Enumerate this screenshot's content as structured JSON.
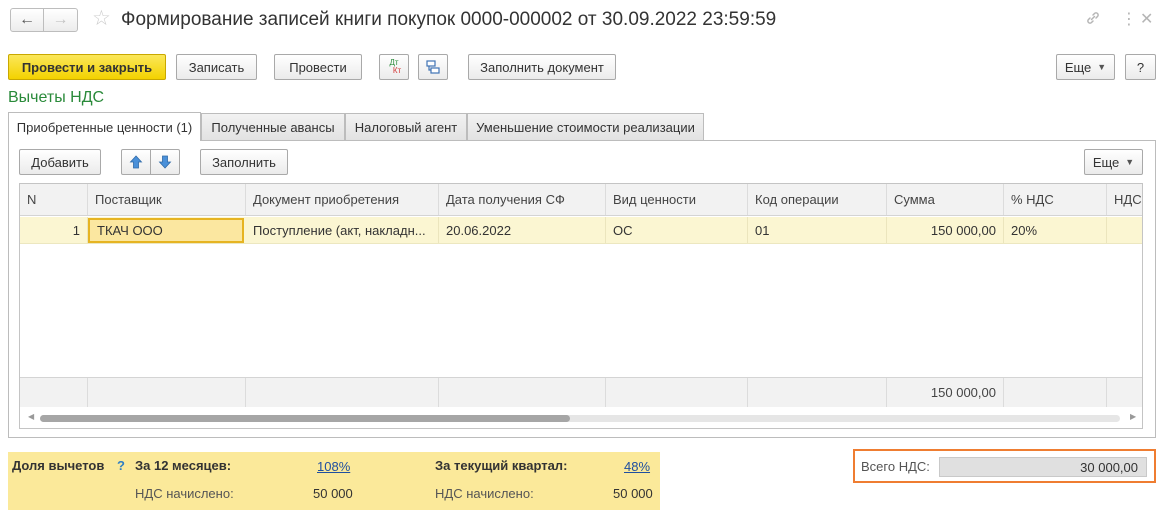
{
  "window": {
    "title": "Формирование записей книги покупок 0000-000002 от 30.09.2022 23:59:59",
    "back_icon": "←",
    "forward_icon": "→",
    "star_icon": "☆",
    "link_icon": "🔗",
    "more_icon": "⋮",
    "close_icon": "✕"
  },
  "toolbar": {
    "post_close": "Провести и закрыть",
    "save": "Записать",
    "post": "Провести",
    "dtkt_top": "Дт",
    "dtkt_bottom": "Кт",
    "fill_document": "Заполнить документ",
    "more": "Еще",
    "help": "?"
  },
  "section_title": "Вычеты НДС",
  "tabs": [
    {
      "label": "Приобретенные ценности (1)",
      "active": true
    },
    {
      "label": "Полученные авансы",
      "active": false
    },
    {
      "label": "Налоговый агент",
      "active": false
    },
    {
      "label": "Уменьшение стоимости реализации",
      "active": false
    }
  ],
  "table_toolbar": {
    "add": "Добавить",
    "up_icon": "🡅",
    "down_icon": "🡇",
    "fill": "Заполнить",
    "more": "Еще"
  },
  "table": {
    "columns": [
      "N",
      "Поставщик",
      "Документ приобретения",
      "Дата получения СФ",
      "Вид ценности",
      "Код операции",
      "Сумма",
      "% НДС",
      "НДС"
    ],
    "rows": [
      {
        "n": "1",
        "supplier": "ТКАЧ ООО",
        "document": "Поступление (акт, накладн...",
        "date": "20.06.2022",
        "kind": "ОС",
        "op_code": "01",
        "sum": "150 000,00",
        "vat_rate": "20%",
        "vat": ""
      }
    ],
    "footer": {
      "sum": "150 000,00"
    }
  },
  "bottom": {
    "share_label": "Доля вычетов",
    "help": "?",
    "period12_label": "За 12 месяцев:",
    "period12_link": "108%",
    "vat_accrued_label1": "НДС начислено:",
    "vat_accrued_value1": "50 000",
    "quarter_label": "За текущий квартал:",
    "quarter_link": "48%",
    "vat_accrued_label2": "НДС начислено:",
    "vat_accrued_value2": "50 000",
    "total_vat_label": "Всего НДС:",
    "total_vat_value": "30 000,00"
  },
  "colors": {
    "primary_button": "#f3d200",
    "section_title": "#2a8a3a",
    "highlight_border": "#ef7d31",
    "row_background": "#fbf6d2",
    "info_panel": "#fbe99a"
  }
}
